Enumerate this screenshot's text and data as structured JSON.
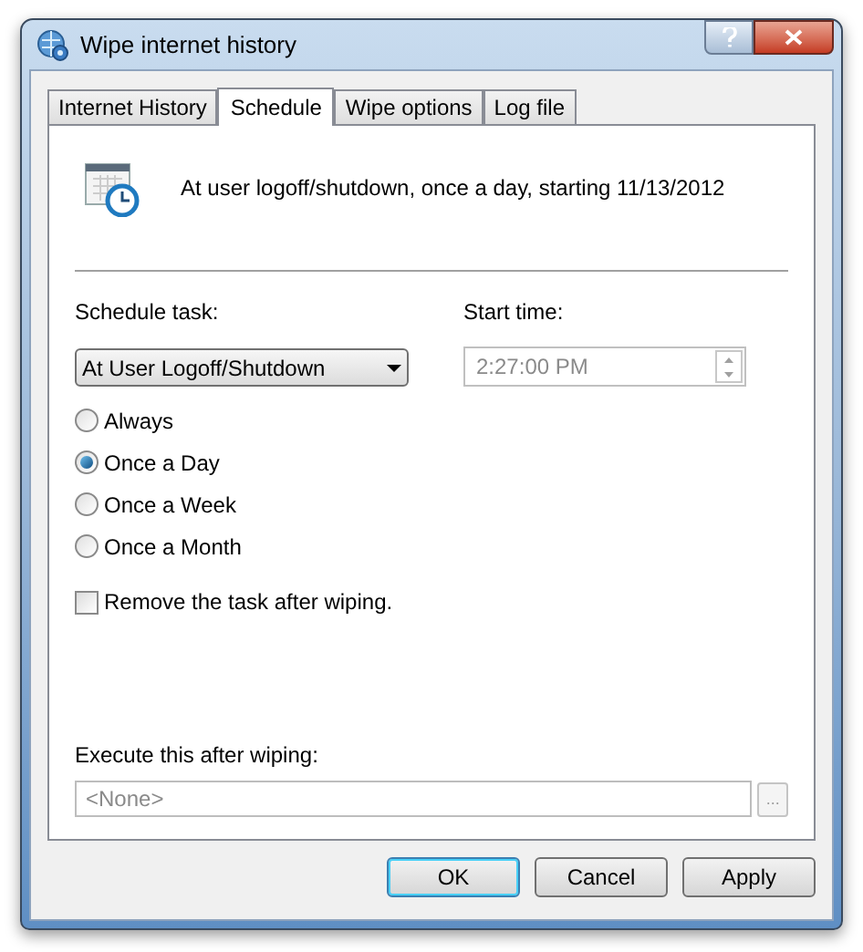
{
  "window": {
    "title": "Wipe internet history"
  },
  "tabs": [
    {
      "label": "Internet History",
      "selected": false
    },
    {
      "label": "Schedule",
      "selected": true
    },
    {
      "label": "Wipe options",
      "selected": false
    },
    {
      "label": "Log file",
      "selected": false
    }
  ],
  "summary": "At user logoff/shutdown, once a day, starting 11/13/2012",
  "schedule_task": {
    "label": "Schedule task:",
    "value": "At User Logoff/Shutdown"
  },
  "start_time": {
    "label": "Start time:",
    "value": "2:27:00 PM",
    "disabled": true
  },
  "frequency": [
    {
      "label": "Always",
      "selected": false
    },
    {
      "label": "Once a Day",
      "selected": true
    },
    {
      "label": "Once a Week",
      "selected": false
    },
    {
      "label": "Once a Month",
      "selected": false
    }
  ],
  "remove_task": {
    "label": "Remove the task after wiping.",
    "checked": false
  },
  "execute": {
    "label": "Execute this after wiping:",
    "value": "<None>",
    "disabled": true,
    "browse": "..."
  },
  "buttons": [
    {
      "label": "OK",
      "default": true
    },
    {
      "label": "Cancel",
      "default": false
    },
    {
      "label": "Apply",
      "default": false
    }
  ]
}
